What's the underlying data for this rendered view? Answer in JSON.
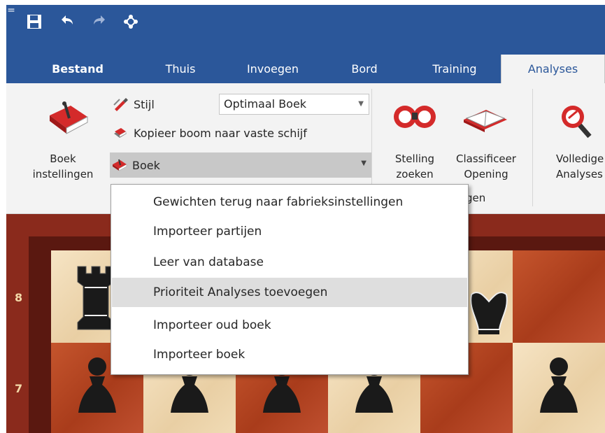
{
  "quick_access": {
    "icons": [
      "save-icon",
      "undo-icon",
      "redo-icon",
      "engine-tree-icon"
    ],
    "more_label": "="
  },
  "tabs": [
    {
      "label": "Bestand",
      "file": true
    },
    {
      "label": "Thuis"
    },
    {
      "label": "Invoegen"
    },
    {
      "label": "Bord"
    },
    {
      "label": "Training"
    },
    {
      "label": "Analyses",
      "active": true
    }
  ],
  "ribbon": {
    "book_settings": {
      "line1": "Boek",
      "line2": "instellingen"
    },
    "style_label": "Stijl",
    "copy_tree_label": "Kopieer boom naar vaste schijf",
    "book_combo_value": "Optimaal Boek",
    "book_dropdown_label": "Boek",
    "search_position": {
      "line1": "Stelling",
      "line2": "zoeken"
    },
    "classify_opening": {
      "line1": "Classificeer",
      "line2": "Opening"
    },
    "group_label_partial": "gen",
    "full_analysis": {
      "line1": "Volledige",
      "line2": "Analyses"
    }
  },
  "menu": {
    "items": [
      {
        "label": "Gewichten terug naar fabrieksinstellingen"
      },
      {
        "label": "Importeer partijen"
      },
      {
        "label": "Leer van database"
      },
      {
        "label": "Prioriteit Analyses toevoegen",
        "highlighted": true
      },
      {
        "label": "Importeer oud boek"
      },
      {
        "label": "Importeer boek"
      }
    ]
  },
  "board": {
    "rank_labels": [
      "8",
      "7"
    ]
  },
  "colors": {
    "accent": "#2b579a",
    "ribbon_bg": "#f3f3f3",
    "menu_highlight": "#dedede",
    "board_light": "#f1dcb6",
    "board_dark": "#b2431f"
  }
}
